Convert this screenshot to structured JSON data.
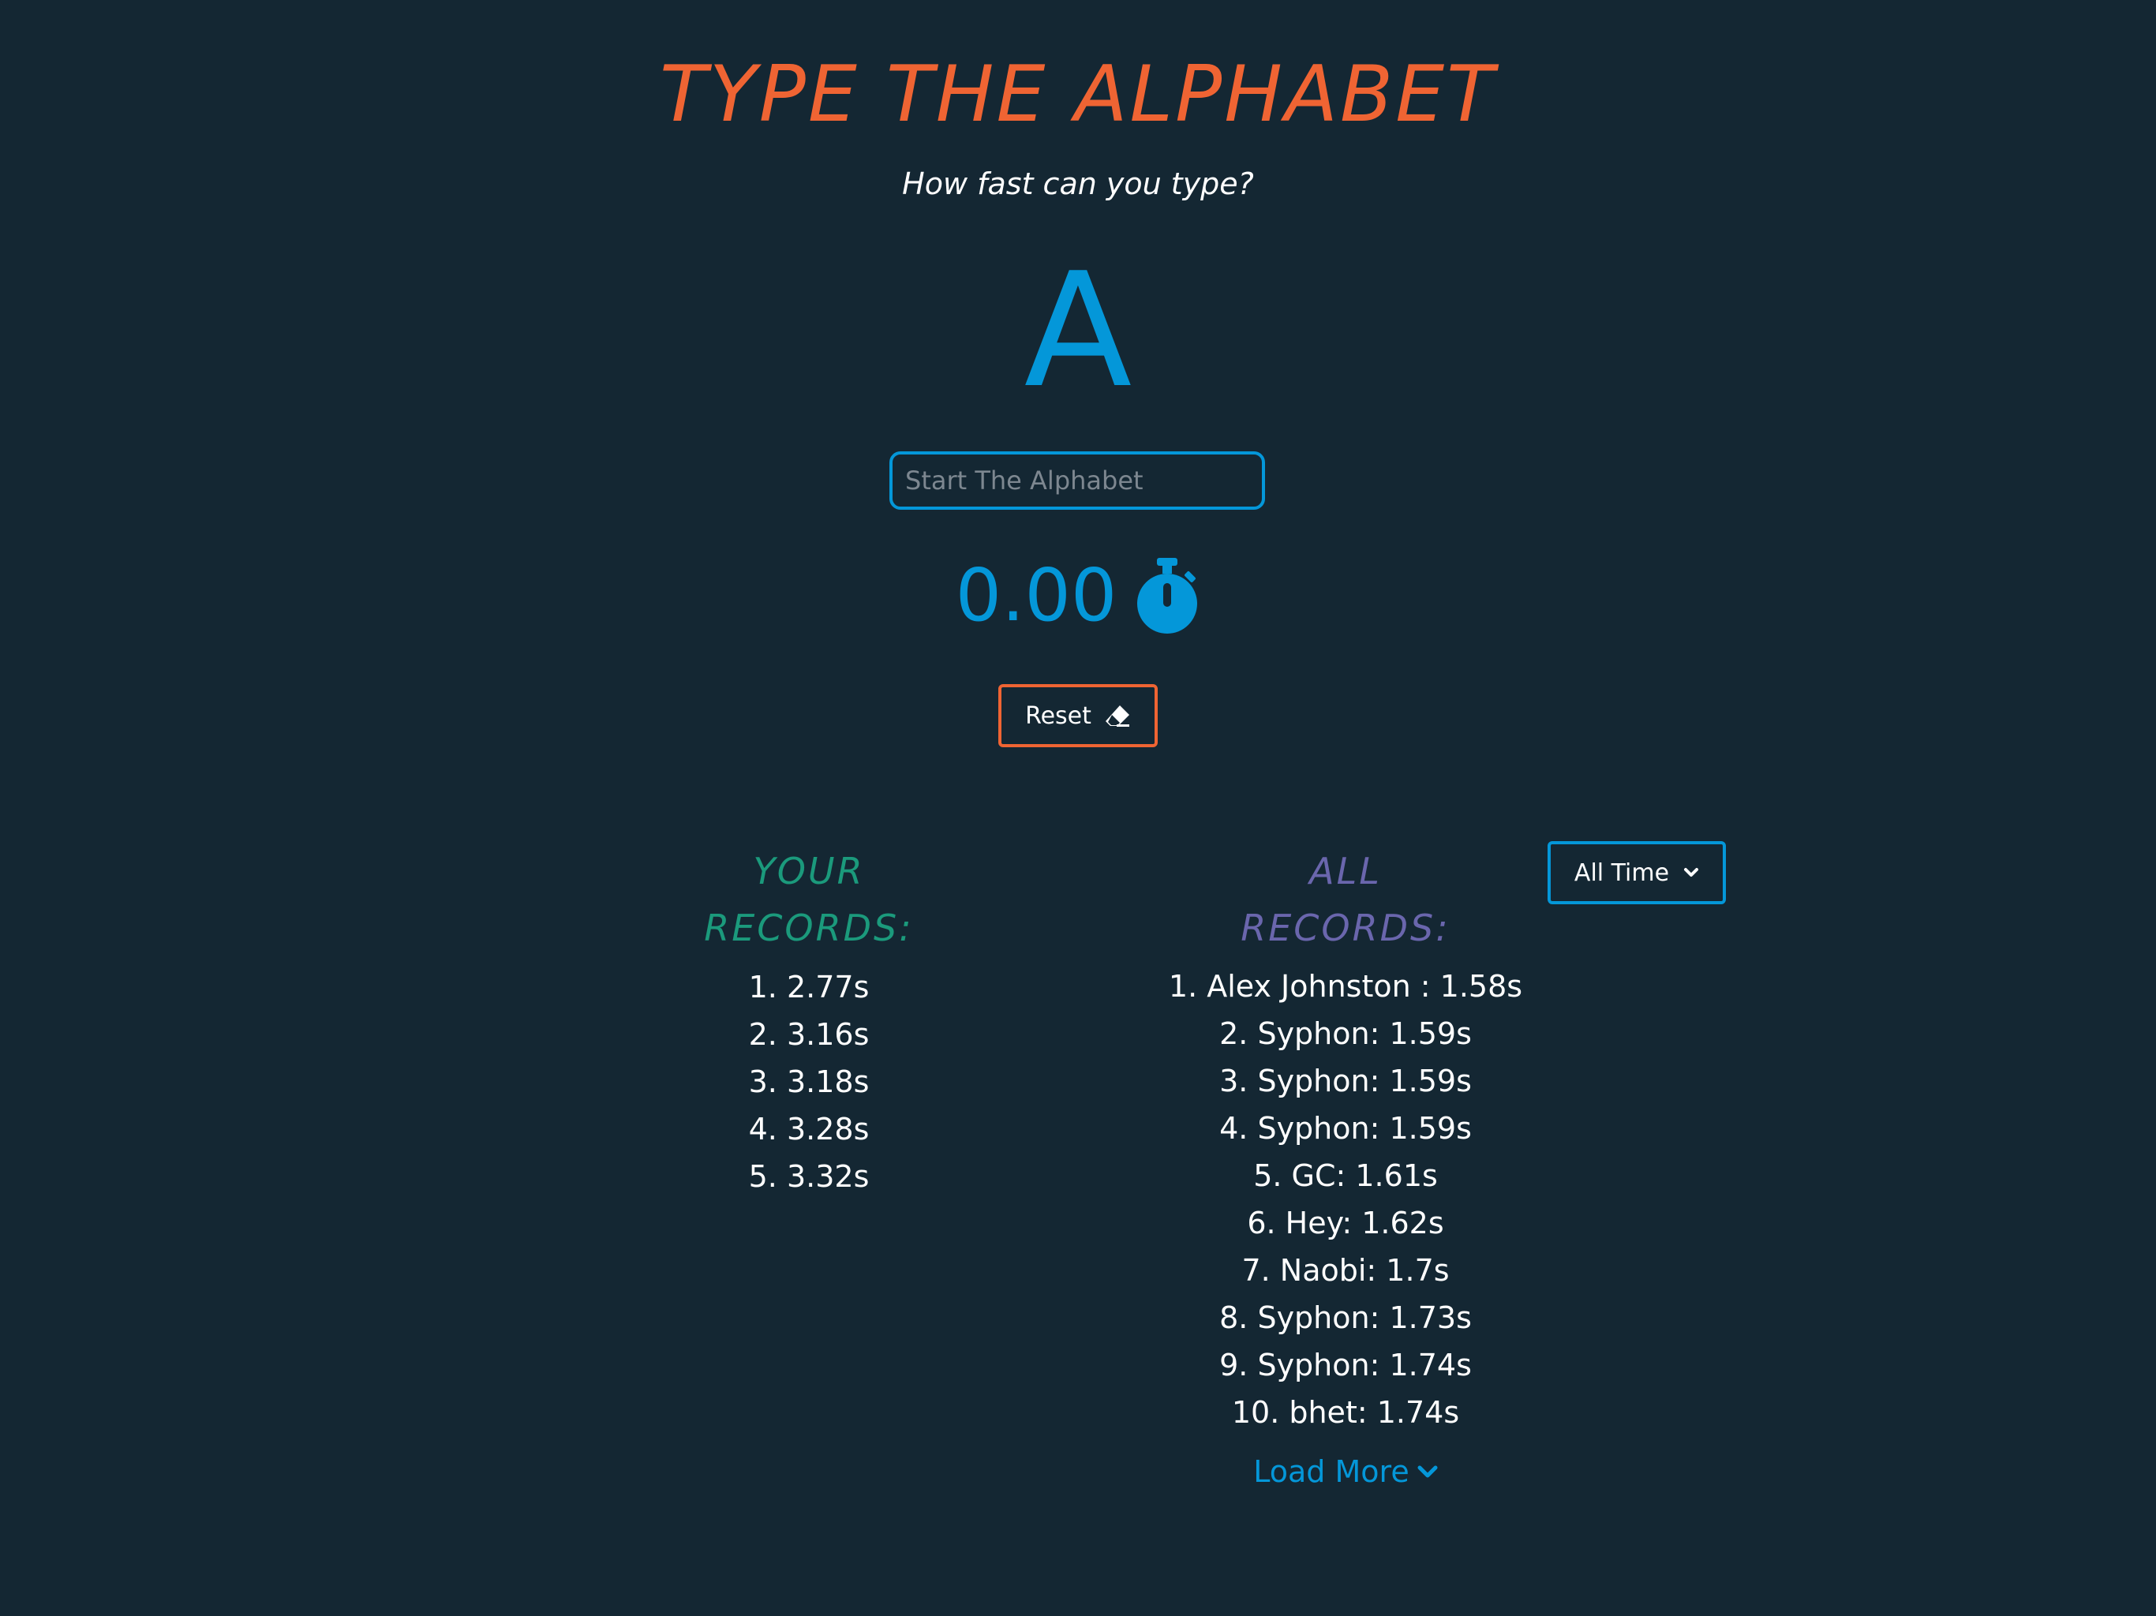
{
  "header": {
    "title": "TYPE THE ALPHABET",
    "subtitle": "How fast can you type?"
  },
  "game": {
    "current_letter": "A",
    "input_placeholder": "Start The Alphabet",
    "timer": "0.00",
    "timer_icon": "stopwatch-icon",
    "reset_label": "Reset",
    "reset_icon": "eraser-icon"
  },
  "your_records": {
    "heading_line1": "YOUR",
    "heading_line2": "RECORDS:",
    "items": [
      "1. 2.77s",
      "2. 3.16s",
      "3. 3.18s",
      "4. 3.28s",
      "5. 3.32s"
    ]
  },
  "all_records": {
    "heading_line1": "ALL",
    "heading_line2": "RECORDS:",
    "items": [
      "1. Alex Johnston : 1.58s",
      "2. Syphon: 1.59s",
      "3. Syphon: 1.59s",
      "4. Syphon: 1.59s",
      "5. GC: 1.61s",
      "6. Hey: 1.62s",
      "7. Naobi: 1.7s",
      "8. Syphon: 1.73s",
      "9. Syphon: 1.74s",
      "10. bhet: 1.74s"
    ],
    "load_more_label": "Load More"
  },
  "filter": {
    "selected": "All Time"
  },
  "colors": {
    "background": "#142733",
    "accent_orange": "#ef6433",
    "accent_blue": "#0497d9",
    "your_records_green": "#1b9a7c",
    "all_records_purple": "#6a66ad"
  }
}
